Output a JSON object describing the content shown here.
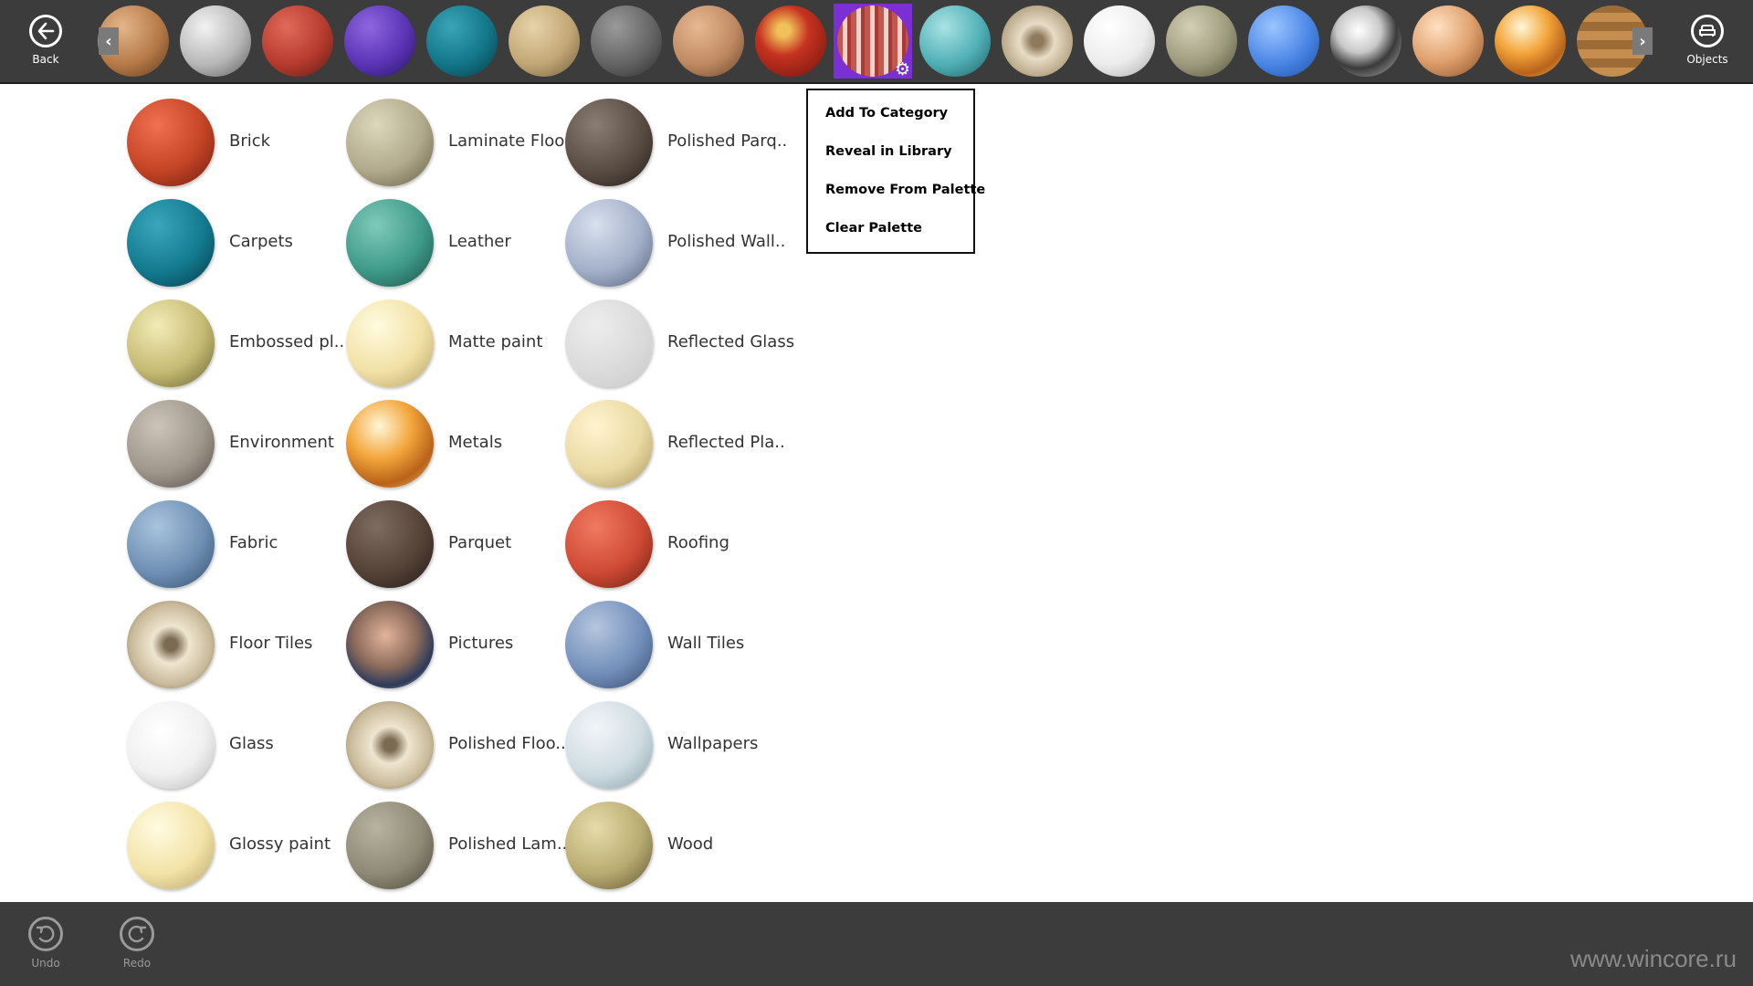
{
  "topbar": {
    "back_label": "Back",
    "objects_label": "Objects",
    "scroll_left": "‹",
    "scroll_right": "›",
    "selected_icon": "gear-icon",
    "palette": [
      {
        "name": "brick-tan",
        "bg": "radial-gradient(circle at 35% 30%, #e3b58a, #b77a48 55%, #5e3a1e)"
      },
      {
        "name": "stone-wall",
        "bg": "radial-gradient(circle at 35% 30%, #f2f2f2, #b8b8b8 55%, #5c5c5c)"
      },
      {
        "name": "brick-red",
        "bg": "radial-gradient(circle at 35% 30%, #e06a5a, #b73b2e 55%, #5a1a14)"
      },
      {
        "name": "carpet-purple",
        "bg": "radial-gradient(circle at 35% 30%, #8e66e0, #5a34b5 55%, #271460)"
      },
      {
        "name": "carpet-teal",
        "bg": "radial-gradient(circle at 35% 30%, #3aa5b8, #137689 55%, #073a44)"
      },
      {
        "name": "plaster-beige",
        "bg": "radial-gradient(circle at 35% 30%, #e6d3a8, #c2a776 55%, #6e5c3a)"
      },
      {
        "name": "cobblestone",
        "bg": "radial-gradient(circle at 35% 30%, #9a9a9a, #656565 55%, #2c2c2c)"
      },
      {
        "name": "pattern-copper",
        "bg": "radial-gradient(circle at 35% 30%, #e7b892, #bf8a62 55%, #6a442a)"
      },
      {
        "name": "pattern-red-dots",
        "bg": "radial-gradient(circle at 40% 35%, #f1c15a 10%, #c63220 40%, #6e140c)"
      },
      {
        "name": "stripes-selected",
        "bg": "repeating-linear-gradient(90deg, #c2574e 0 6px, #f0d2c8 6px 11px, #a63a35 11px 15px)"
      },
      {
        "name": "tile-turquoise",
        "bg": "radial-gradient(circle at 35% 30%, #a9e2e4, #4fb0b6 55%, #1e5d62)"
      },
      {
        "name": "tile-mosaic",
        "bg": "radial-gradient(circle at 50% 50%, #8f7a5c 12%, #e7dcc6 35%, #b9a98a 70%, #6b5b40)"
      },
      {
        "name": "white-glossy",
        "bg": "radial-gradient(circle at 35% 30%, #ffffff, #ececec 55%, #a9a9a9)"
      },
      {
        "name": "fabric-olive",
        "bg": "radial-gradient(circle at 35% 30%, #d2cfb6, #9e9b7d 55%, #51503b)"
      },
      {
        "name": "blue-matte",
        "bg": "radial-gradient(circle at 35% 30%, #9cc4ff, #4a86e6 55%, #1d4ea3)"
      },
      {
        "name": "chrome",
        "bg": "radial-gradient(circle at 40% 35%, #ffffff, #c9c9c9 35%, #3a3a3a 60%, #bdbdbd)"
      },
      {
        "name": "copper",
        "bg": "radial-gradient(circle at 35% 30%, #ffe0c2, #e1a26f 50%, #8a4f24)"
      },
      {
        "name": "gold-metal",
        "bg": "radial-gradient(circle at 38% 30%, #fff6d8, #f3a53a 40%, #b8621a 70%, #f0c060)"
      },
      {
        "name": "parquet-check",
        "bg": "repeating-linear-gradient(0deg, #c58e4e 0 10px, #9d6b35 10px 20px)"
      }
    ]
  },
  "categories": [
    {
      "label": "Brick",
      "bg": "radial-gradient(circle at 35% 30%, #f07050, #c44426 55%, #6b1c0e)"
    },
    {
      "label": "Carpets",
      "bg": "radial-gradient(circle at 35% 30%, #3aa6bc, #137b90 55%, #073845)"
    },
    {
      "label": "Embossed pl..",
      "bg": "radial-gradient(circle at 35% 30%, #f1ebb6, #c6bb74 55%, #67602f)"
    },
    {
      "label": "Environment",
      "bg": "radial-gradient(circle at 35% 30%, #cdc4b8, #a0978c 55%, #544e46)"
    },
    {
      "label": "Fabric",
      "bg": "radial-gradient(circle at 35% 30%, #a9c3dd, #6f90b4 55%, #324e6d)"
    },
    {
      "label": "Floor Tiles",
      "bg": "radial-gradient(circle at 50% 50%, #7b6a52 10%, #efe6d0 30%, #c8b999 65%, #6b5c40)"
    },
    {
      "label": "Glass",
      "bg": "radial-gradient(circle at 40% 35%, #ffffff, #f0f0f0 55%, #b9b9b9)"
    },
    {
      "label": "Glossy paint",
      "bg": "radial-gradient(circle at 35% 30%, #fffbe2, #f3e3a7 55%, #b4a166)"
    },
    {
      "label": "Laminate Floor",
      "bg": "radial-gradient(circle at 35% 30%, #dcd7bd, #b1aa8b 55%, #625c46)"
    },
    {
      "label": "Leather",
      "bg": "radial-gradient(circle at 35% 30%, #7fcab9, #3f9a8a 55%, #1a4d44)"
    },
    {
      "label": "Matte paint",
      "bg": "radial-gradient(circle at 35% 30%, #fffbe0, #f2e1a5 55%, #b39e62)"
    },
    {
      "label": "Metals",
      "bg": "radial-gradient(circle at 38% 30%, #fff6d8, #f3a53a 40%, #b8621a 70%, #f0c060)"
    },
    {
      "label": "Parquet",
      "bg": "radial-gradient(circle at 35% 30%, #7e6c60, #554338 55%, #231a15)"
    },
    {
      "label": "Pictures",
      "bg": "radial-gradient(circle at 45% 40%, #e3b49a, #8a6a5a 45%, #2d3a5a 70%, #d8d0c4)"
    },
    {
      "label": "Polished Floo..",
      "bg": "radial-gradient(circle at 50% 50%, #7b6a52 10%, #efe6d0 30%, #c8b999 65%, #6b5c40)"
    },
    {
      "label": "Polished Lam..",
      "bg": "radial-gradient(circle at 35% 30%, #b8b3a0, #8f8a76 55%, #4a4638)"
    },
    {
      "label": "Polished Parq..",
      "bg": "radial-gradient(circle at 35% 30%, #8a7d73, #5a4d44 55%, #261e19)"
    },
    {
      "label": "Polished Wall..",
      "bg": "radial-gradient(circle at 35% 30%, #d8e0ee, #a3b0c9 55%, #556179)"
    },
    {
      "label": "Reflected Glass",
      "bg": "radial-gradient(circle at 35% 30%, #ededed, #d9d9d9 60%, #c8c8c8)"
    },
    {
      "label": "Reflected Pla..",
      "bg": "radial-gradient(circle at 35% 30%, #fff4d0, #ead9a2 55%, #a9955d)"
    },
    {
      "label": "Roofing",
      "bg": "radial-gradient(circle at 35% 30%, #f07a5f, #cf4a34 55%, #6a1e13)"
    },
    {
      "label": "Wall Tiles",
      "bg": "radial-gradient(circle at 35% 30%, #b5c5de, #7390bb 55%, #354a6b)"
    },
    {
      "label": "Wallpapers",
      "bg": "radial-gradient(circle at 35% 30%, #f2f5f7, #cfdde3 55%, #8aa0aa)"
    },
    {
      "label": "Wood",
      "bg": "radial-gradient(circle at 35% 30%, #e6dcaa, #b9ac72 55%, #5e5530)"
    }
  ],
  "context_menu": [
    {
      "label": "Add To Category"
    },
    {
      "label": "Reveal in Library"
    },
    {
      "label": "Remove From Palette"
    },
    {
      "label": "Clear Palette"
    }
  ],
  "bottombar": {
    "undo_label": "Undo",
    "redo_label": "Redo",
    "watermark": "www.wincore.ru"
  }
}
